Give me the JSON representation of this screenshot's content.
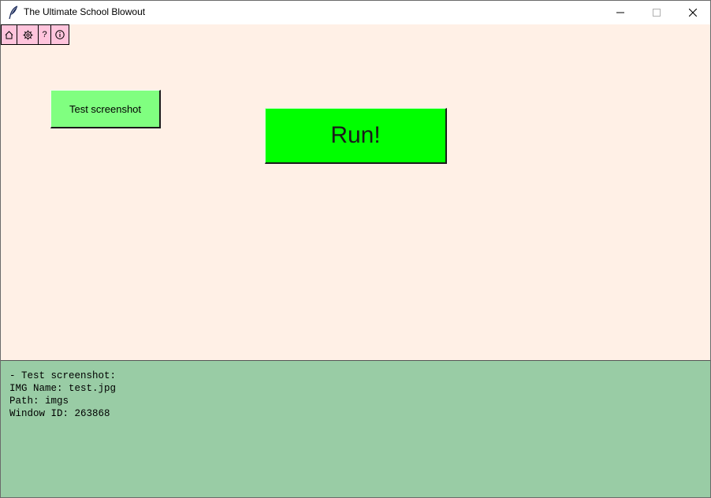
{
  "window": {
    "title": "The Ultimate School Blowout"
  },
  "icons": {
    "app": "feather-icon",
    "minimize": "minimize-icon",
    "maximize": "maximize-icon",
    "close": "close-icon"
  },
  "toolbar": {
    "home_icon": "home-icon",
    "settings_icon": "gear-icon",
    "help_label": "?",
    "info_icon": "info-icon"
  },
  "main": {
    "test_button_label": "Test screenshot",
    "run_button_label": "Run!"
  },
  "console": {
    "lines": [
      "- Test screenshot:",
      "IMG Name: test.jpg",
      "Path: imgs",
      "Window ID: 263868"
    ]
  },
  "colors": {
    "main_background": "#fff0e6",
    "toolbar_button": "#ffc4dc",
    "test_button": "#80ff80",
    "run_button": "#00ff00",
    "console_background": "#99cca5"
  }
}
